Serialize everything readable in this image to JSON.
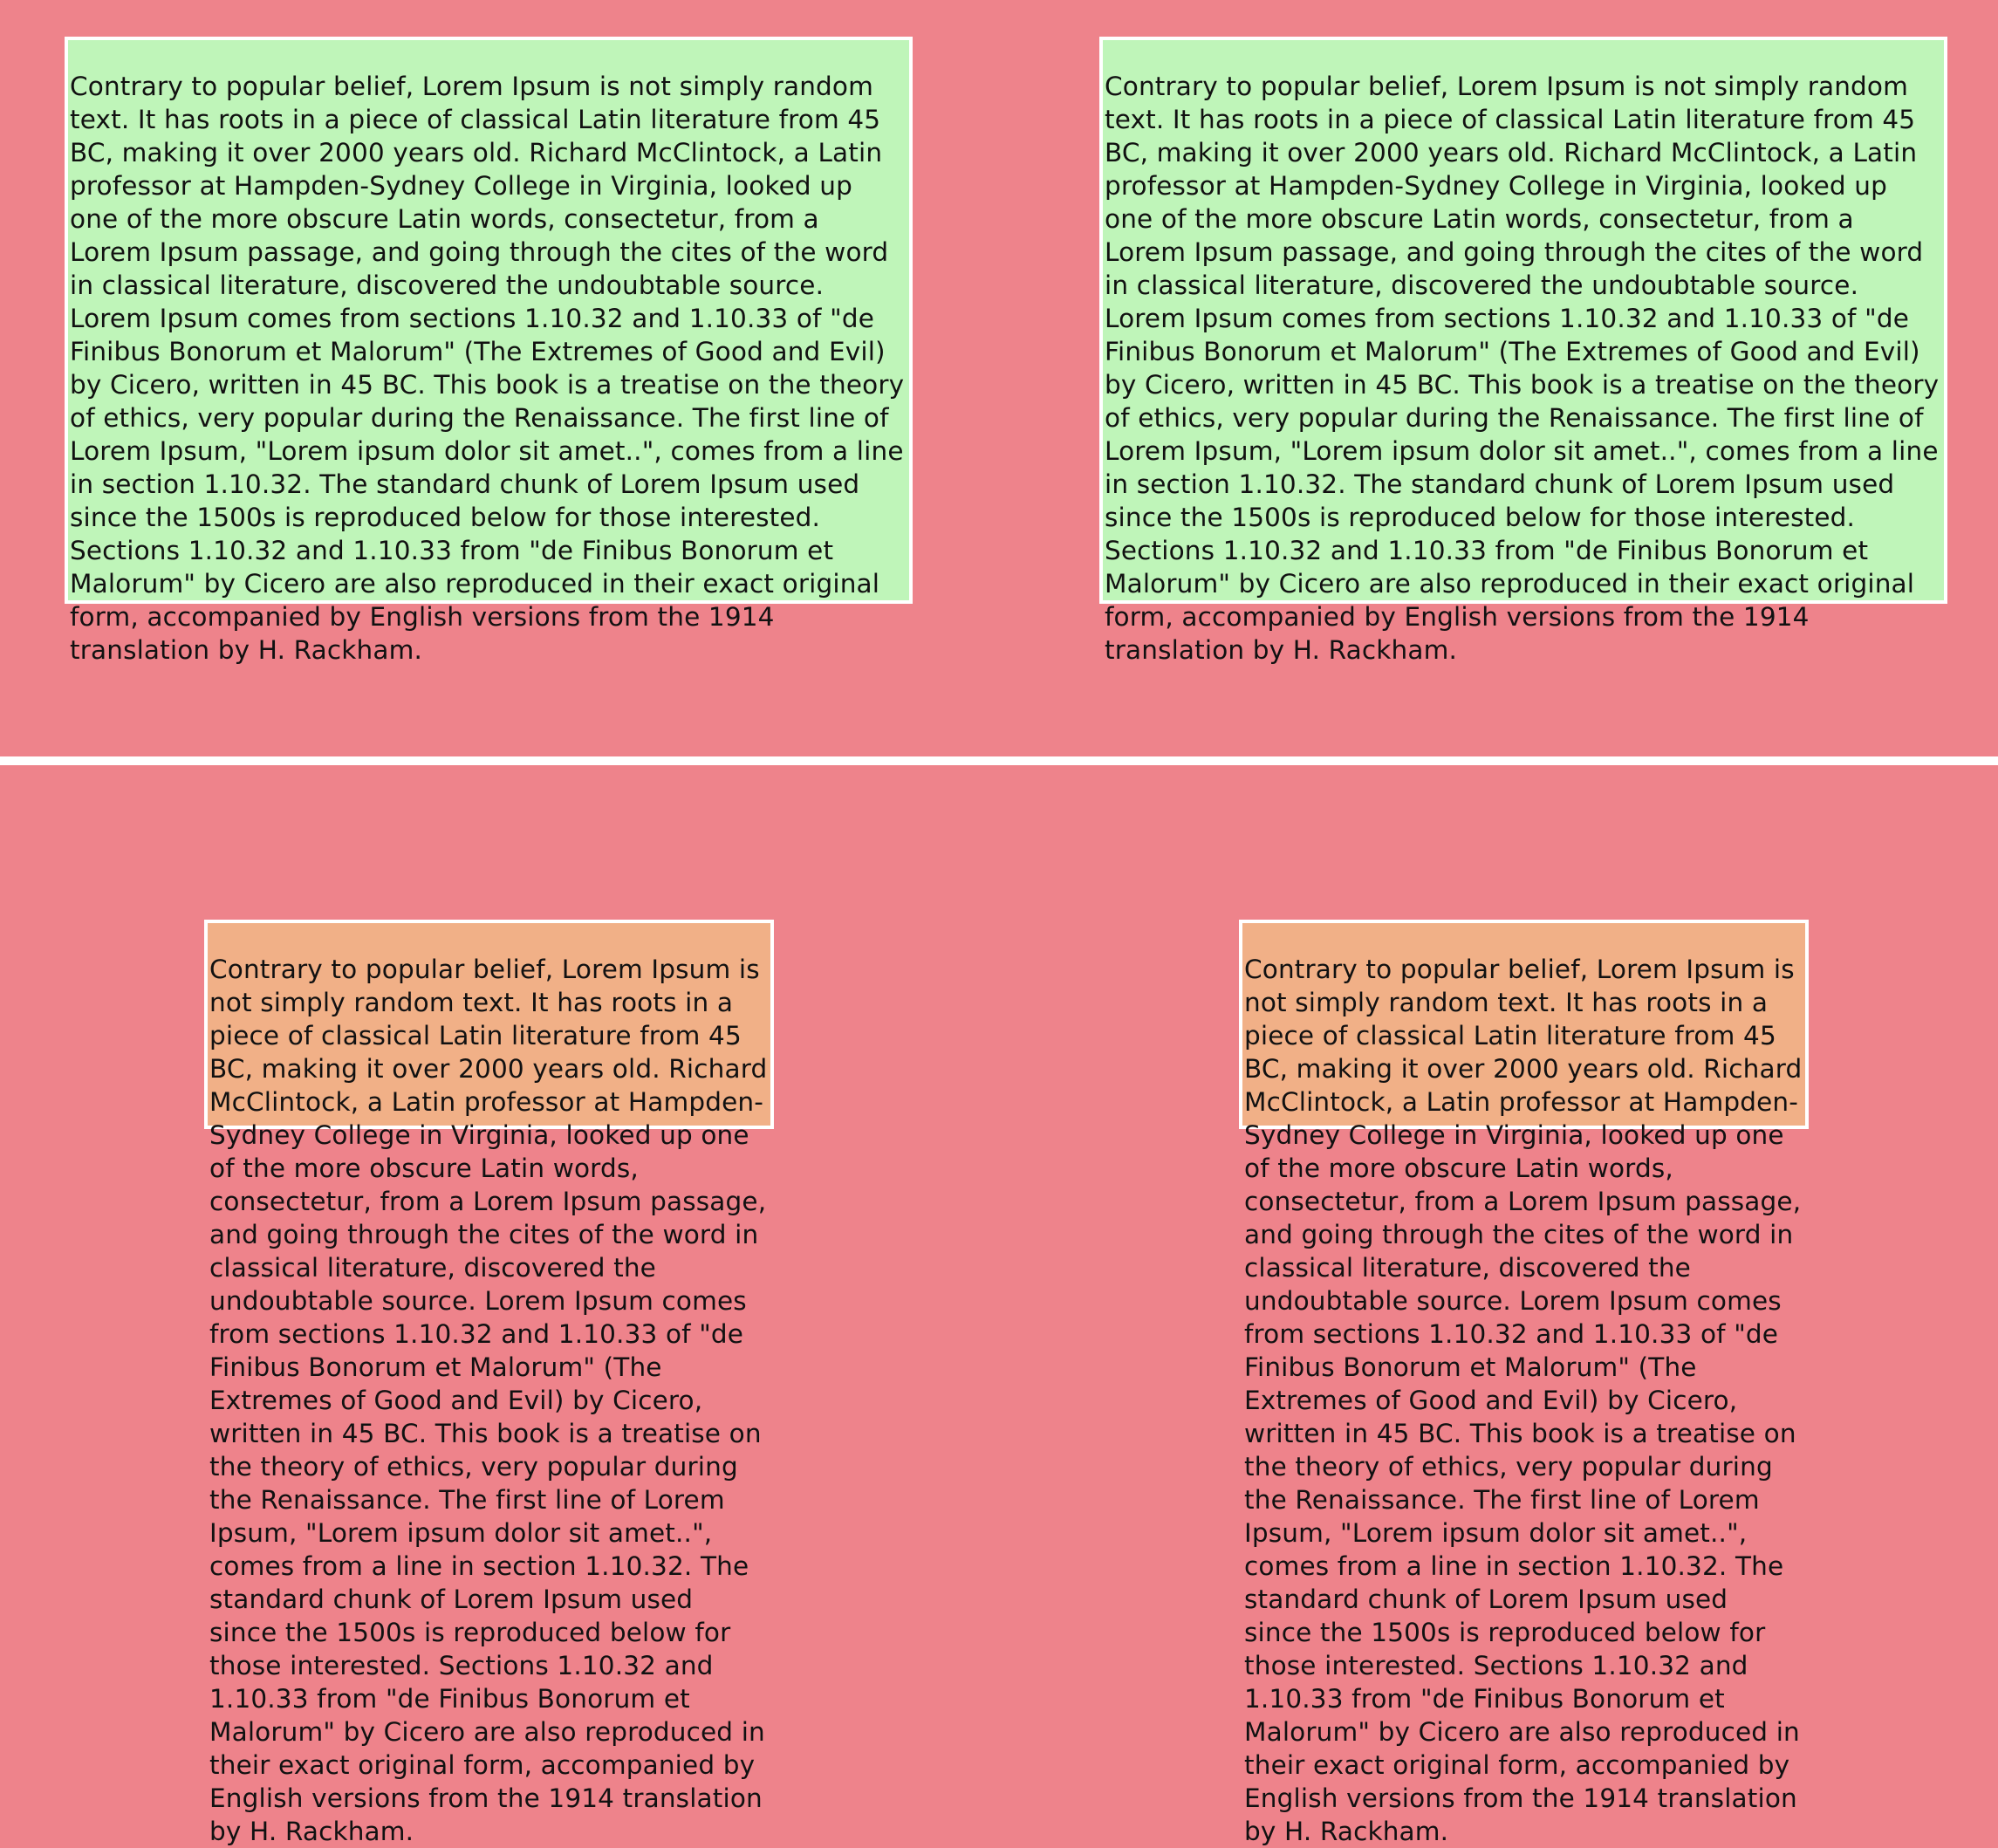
{
  "paragraph": "Contrary to popular belief, Lorem Ipsum is not simply random text. It has roots in a piece of classical Latin literature from 45 BC, making it over 2000 years old. Richard McClintock, a Latin professor at Hampden-Sydney College in Virginia, looked up one of the more obscure Latin words, consectetur, from a Lorem Ipsum passage, and going through the cites of the word in classical literature, discovered the undoubtable source. Lorem Ipsum comes from sections 1.10.32 and 1.10.33 of \"de Finibus Bonorum et Malorum\" (The Extremes of Good and Evil) by Cicero, written in 45 BC. This book is a treatise on the theory of ethics, very popular during the Renaissance. The first line of Lorem Ipsum, \"Lorem ipsum dolor sit amet..\", comes from a line in section 1.10.32. The standard chunk of Lorem Ipsum used since the 1500s is reproduced below for those interested. Sections 1.10.32 and 1.10.33 from \"de Finibus Bonorum et Malorum\" by Cicero are also reproduced in their exact original form, accompanied by English versions from the 1914 translation by H. Rackham.",
  "colors": {
    "page_background": "#ee838b",
    "green_panel": "#bff5b9",
    "orange_panel": "#f1b087",
    "panel_border": "#ffffff",
    "divider": "#ffffff",
    "text": "#111111"
  }
}
